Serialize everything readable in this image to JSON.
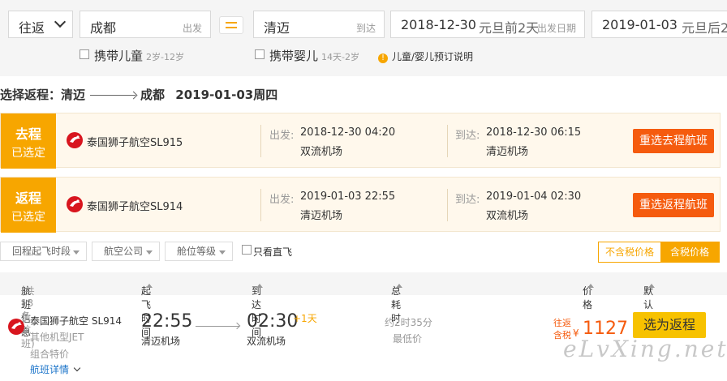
{
  "search": {
    "trip_type": "往返",
    "from_city": "成都",
    "from_label": "出发",
    "to_city": "清迈",
    "to_label": "到达",
    "depart_date": "2018-12-30",
    "depart_note": "元旦前2天",
    "depart_label": "出发日期",
    "return_date": "2019-01-03",
    "return_note": "元旦后2",
    "child_label": "携带儿童",
    "child_note": "2岁-12岁",
    "infant_label": "携带婴儿",
    "infant_note": "14天-2岁",
    "info_link": "儿童/婴儿预订说明",
    "info_icon": "!"
  },
  "title": {
    "prefix": "选择返程：清迈",
    "dest": "成都",
    "date": "2019-01-03周四"
  },
  "outbound": {
    "tag1": "去程",
    "tag2": "已选定",
    "airline": "泰国狮子航空SL915",
    "dep_label": "出发:",
    "dep_time": "2018-12-30 04:20",
    "dep_airport": "双流机场",
    "arr_label": "到达:",
    "arr_time": "2018-12-30 06:15",
    "arr_airport": "清迈机场",
    "button": "重选去程航班"
  },
  "inbound": {
    "tag1": "返程",
    "tag2": "已选定",
    "airline": "泰国狮子航空SL914",
    "dep_label": "出发:",
    "dep_time": "2019-01-03 22:55",
    "dep_airport": "清迈机场",
    "arr_label": "到达:",
    "arr_time": "2019-01-04 02:30",
    "arr_airport": "双流机场",
    "button": "重选返程航班"
  },
  "filters": {
    "f1": "回程起飞时段",
    "f2": "航空公司",
    "f3": "舱位等级",
    "direct": "只看直飞",
    "no_tax": "不含税价格",
    "with_tax": "含税价格"
  },
  "header": {
    "info": "航班信息",
    "count": "(共13条航班)",
    "dep": "起飞时间",
    "arr": "到达时间",
    "dur": "总耗时",
    "price": "价格",
    "sort": "默认排序"
  },
  "flight": {
    "airline": "泰国狮子航空",
    "code": "SL914",
    "plane": "其他机型JET",
    "fare": "组合特价",
    "details": "航班详情",
    "dep_time": "22:55",
    "dep_airport": "清迈机场",
    "arr_time": "02:30",
    "plus_day": "+1天",
    "arr_airport": "双流机场",
    "duration": "约2时35分",
    "lowest": "最低价",
    "price_label1": "往返",
    "price_label2": "含税",
    "currency": "¥",
    "price": "1127",
    "select": "选为返程"
  },
  "watermark": "eLvXing.net",
  "colors": {
    "accent": "#f7a600",
    "orange": "#f55b0e",
    "yellow": "#f7c200",
    "airline_red": "#d8151e"
  }
}
